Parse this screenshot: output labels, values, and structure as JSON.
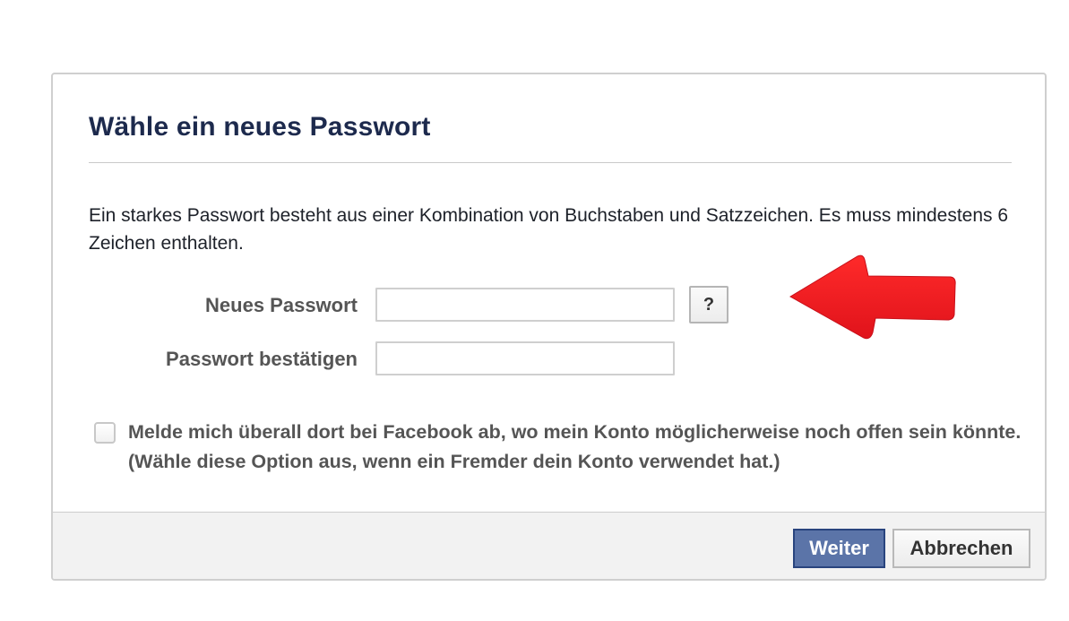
{
  "dialog": {
    "title": "Wähle ein neues Passwort",
    "description": "Ein starkes Passwort besteht aus einer Kombination von Buchstaben und Satzzeichen. Es muss mindestens 6 Zeichen enthalten.",
    "fields": {
      "new_password_label": "Neues Passwort",
      "new_password_value": "",
      "confirm_password_label": "Passwort bestätigen",
      "confirm_password_value": "",
      "help_button_label": "?"
    },
    "logout_option": {
      "checked": false,
      "label": "Melde mich überall dort bei Facebook ab, wo mein Konto möglicherweise noch offen sein könnte. (Wähle diese Option aus, wenn ein Fremder dein Konto verwendet hat.)"
    },
    "footer": {
      "continue_label": "Weiter",
      "cancel_label": "Abbrechen"
    }
  },
  "annotation": {
    "arrow_icon": "red-arrow-left-icon",
    "arrow_color": "#ee1c25"
  },
  "colors": {
    "title": "#1d2a4d",
    "primary_button": "#5b74a8",
    "primary_button_border": "#29447e",
    "footer_bg": "#f2f2f2"
  }
}
